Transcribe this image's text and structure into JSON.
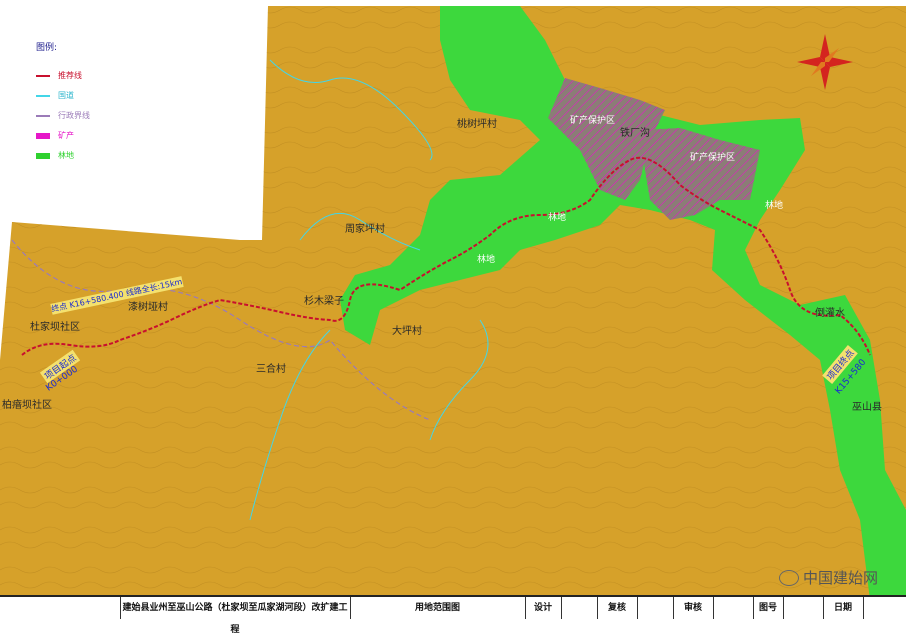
{
  "legend": {
    "title": "图例:",
    "items": [
      {
        "label": "推荐线",
        "color": "#c8102e"
      },
      {
        "label": "国道",
        "color": "#43d6e8"
      },
      {
        "label": "行政界线",
        "color": "#9b7bb8"
      },
      {
        "label": "矿产",
        "color": "#e617c8"
      },
      {
        "label": "林地",
        "color": "#2fd12f"
      }
    ]
  },
  "places": {
    "taoshu": "桃树坪村",
    "tiechang": "铁厂沟",
    "zhoujia": "周家坪村",
    "shamu": "杉木梁子",
    "dazhen": "大坪村",
    "sanhe": "三合村",
    "tujia": "杜家坝社区",
    "bochi": "柏瘖坝社区",
    "zhouyou": "漆树垭村",
    "daoguan": "倒灌水",
    "wushan": "巫山县"
  },
  "zone_labels": {
    "z1": "矿产保护区",
    "z2": "矿产保护区",
    "forest1": "林地",
    "forest2": "林地",
    "forest3": "林地"
  },
  "road_labels": {
    "start": "项目起点",
    "start_km": "K0+000",
    "end": "项目终点",
    "end_km": "K15+580",
    "spec": "终点 K16+580.400 线路全长:15km"
  },
  "title_block": {
    "project": "建始县业州至巫山公路（杜家坝至瓜家湖河段）改扩建工程",
    "drawing": "用地范围图",
    "design": "设计",
    "check": "复核",
    "review": "审核",
    "number": "图号",
    "date": "日期"
  },
  "watermark": "中国建始网",
  "colors": {
    "terrain": "#d7a22a",
    "forest": "#3dd83d",
    "mine": "#8a7a72",
    "route": "#c8102e"
  }
}
